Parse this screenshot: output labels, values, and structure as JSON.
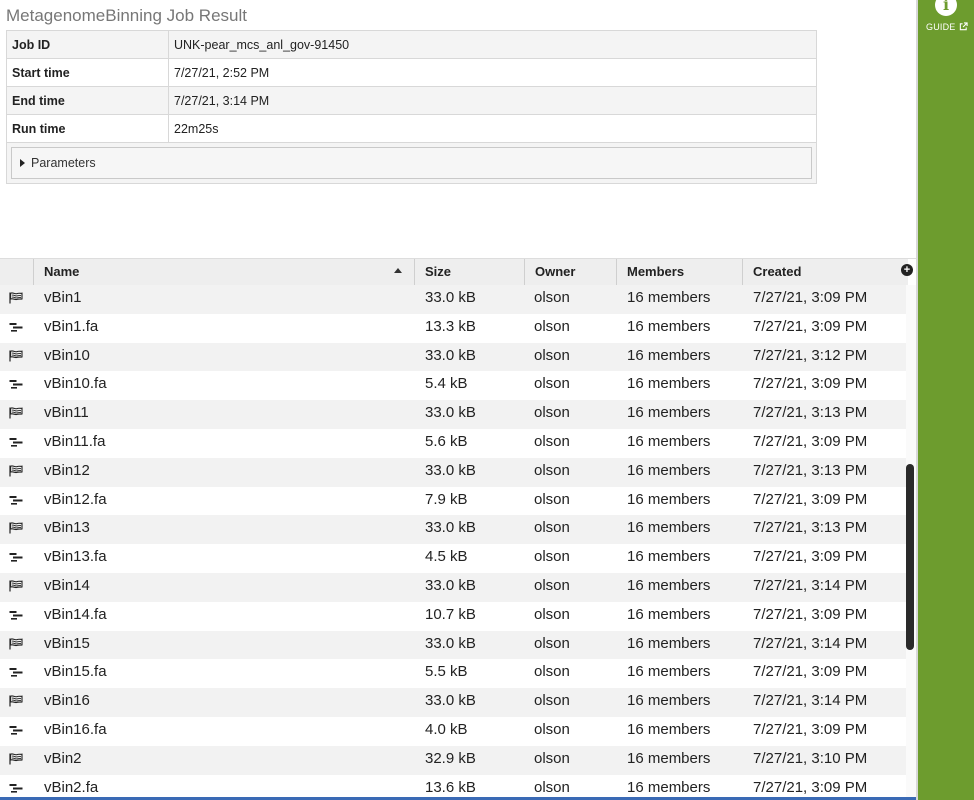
{
  "job": {
    "title": "MetagenomeBinning Job Result",
    "fields": [
      {
        "label": "Job ID",
        "value": "UNK-pear_mcs_anl_gov-91450"
      },
      {
        "label": "Start time",
        "value": "7/27/21, 2:52 PM"
      },
      {
        "label": "End time",
        "value": "7/27/21, 3:14 PM"
      },
      {
        "label": "Run time",
        "value": "22m25s"
      }
    ],
    "parameters_label": "Parameters"
  },
  "grid": {
    "columns": {
      "name": "Name",
      "size": "Size",
      "owner": "Owner",
      "members": "Members",
      "created": "Created"
    },
    "sort": {
      "column": "Name",
      "direction": "ascending"
    },
    "rows": [
      {
        "type": "genome-group-icon",
        "name": "vBin1",
        "size": "33.0 kB",
        "owner": "olson",
        "members": "16 members",
        "created": "7/27/21, 3:09 PM"
      },
      {
        "type": "contigs-icon",
        "name": "vBin1.fa",
        "size": "13.3 kB",
        "owner": "olson",
        "members": "16 members",
        "created": "7/27/21, 3:09 PM"
      },
      {
        "type": "genome-group-icon",
        "name": "vBin10",
        "size": "33.0 kB",
        "owner": "olson",
        "members": "16 members",
        "created": "7/27/21, 3:12 PM"
      },
      {
        "type": "contigs-icon",
        "name": "vBin10.fa",
        "size": "5.4 kB",
        "owner": "olson",
        "members": "16 members",
        "created": "7/27/21, 3:09 PM"
      },
      {
        "type": "genome-group-icon",
        "name": "vBin11",
        "size": "33.0 kB",
        "owner": "olson",
        "members": "16 members",
        "created": "7/27/21, 3:13 PM"
      },
      {
        "type": "contigs-icon",
        "name": "vBin11.fa",
        "size": "5.6 kB",
        "owner": "olson",
        "members": "16 members",
        "created": "7/27/21, 3:09 PM"
      },
      {
        "type": "genome-group-icon",
        "name": "vBin12",
        "size": "33.0 kB",
        "owner": "olson",
        "members": "16 members",
        "created": "7/27/21, 3:13 PM"
      },
      {
        "type": "contigs-icon",
        "name": "vBin12.fa",
        "size": "7.9 kB",
        "owner": "olson",
        "members": "16 members",
        "created": "7/27/21, 3:09 PM"
      },
      {
        "type": "genome-group-icon",
        "name": "vBin13",
        "size": "33.0 kB",
        "owner": "olson",
        "members": "16 members",
        "created": "7/27/21, 3:13 PM"
      },
      {
        "type": "contigs-icon",
        "name": "vBin13.fa",
        "size": "4.5 kB",
        "owner": "olson",
        "members": "16 members",
        "created": "7/27/21, 3:09 PM"
      },
      {
        "type": "genome-group-icon",
        "name": "vBin14",
        "size": "33.0 kB",
        "owner": "olson",
        "members": "16 members",
        "created": "7/27/21, 3:14 PM"
      },
      {
        "type": "contigs-icon",
        "name": "vBin14.fa",
        "size": "10.7 kB",
        "owner": "olson",
        "members": "16 members",
        "created": "7/27/21, 3:09 PM"
      },
      {
        "type": "genome-group-icon",
        "name": "vBin15",
        "size": "33.0 kB",
        "owner": "olson",
        "members": "16 members",
        "created": "7/27/21, 3:14 PM"
      },
      {
        "type": "contigs-icon",
        "name": "vBin15.fa",
        "size": "5.5 kB",
        "owner": "olson",
        "members": "16 members",
        "created": "7/27/21, 3:09 PM"
      },
      {
        "type": "genome-group-icon",
        "name": "vBin16",
        "size": "33.0 kB",
        "owner": "olson",
        "members": "16 members",
        "created": "7/27/21, 3:14 PM"
      },
      {
        "type": "contigs-icon",
        "name": "vBin16.fa",
        "size": "4.0 kB",
        "owner": "olson",
        "members": "16 members",
        "created": "7/27/21, 3:09 PM"
      },
      {
        "type": "genome-group-icon",
        "name": "vBin2",
        "size": "32.9 kB",
        "owner": "olson",
        "members": "16 members",
        "created": "7/27/21, 3:10 PM"
      },
      {
        "type": "contigs-icon",
        "name": "vBin2.fa",
        "size": "13.6 kB",
        "owner": "olson",
        "members": "16 members",
        "created": "7/27/21, 3:09 PM"
      }
    ]
  },
  "guide": {
    "icon": "info-icon",
    "label": "GUIDE",
    "external_icon": "external-link-icon"
  },
  "colors": {
    "guide_panel": "#6d9c2e",
    "row_alt": "#f2f2f2",
    "header_bg": "#eeeeee"
  }
}
